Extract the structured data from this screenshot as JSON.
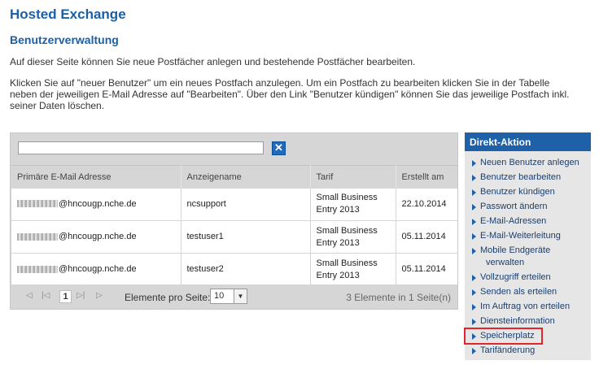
{
  "page": {
    "title": "Hosted Exchange",
    "subtitle": "Benutzerverwaltung",
    "intro": "Auf dieser Seite können Sie neue Postfächer anlegen und bestehende Postfächer bearbeiten.",
    "description": "Klicken Sie auf \"neuer Benutzer\" um ein neues Postfach anzulegen. Um ein Postfach zu bearbeiten klicken Sie in der Tabelle neben der jeweiligen E-Mail Adresse auf \"Bearbeiten\". Über den Link \"Benutzer kündigen\" können Sie das jeweilige Postfach inkl. seiner Daten löschen."
  },
  "grid": {
    "search_value": "",
    "clear_icon": "close-icon",
    "columns": [
      "Primäre E-Mail Adresse",
      "Anzeigename",
      "Tarif",
      "Erstellt am"
    ],
    "rows": [
      {
        "email": "@hncougp.nche.de",
        "name": "ncsupport",
        "tarif_line1": "Small Business",
        "tarif_line2": "Entry 2013",
        "date": "22.10.2014"
      },
      {
        "email": "@hncougp.nche.de",
        "name": "testuser1",
        "tarif_line1": "Small Business",
        "tarif_line2": "Entry 2013",
        "date": "05.11.2014"
      },
      {
        "email": "@hncougp.nche.de",
        "name": "testuser2",
        "tarif_line1": "Small Business",
        "tarif_line2": "Entry 2013",
        "date": "05.11.2014"
      }
    ],
    "pager": {
      "first": "◁",
      "prev": "|◁",
      "current": "1",
      "next": "▷|",
      "last": "▷",
      "per_page_label": "Elemente pro Seite:",
      "per_page_value": "10",
      "info": "3 Elemente in 1 Seite(n)"
    }
  },
  "side": {
    "header": "Direkt-Aktion",
    "items": [
      {
        "label": "Neuen Benutzer anlegen"
      },
      {
        "label": "Benutzer bearbeiten"
      },
      {
        "label": "Benutzer kündigen"
      },
      {
        "label": "Passwort ändern"
      },
      {
        "label": "E-Mail-Adressen"
      },
      {
        "label": "E-Mail-Weiterleitung"
      },
      {
        "label": "Mobile Endgeräte",
        "label2": "verwalten"
      },
      {
        "label": "Vollzugriff erteilen"
      },
      {
        "label": "Senden als erteilen"
      },
      {
        "label": "Im Auftrag von erteilen"
      },
      {
        "label": "Diensteinformation"
      },
      {
        "label": "Speicherplatz",
        "highlighted": true
      },
      {
        "label": "Tarifänderung"
      }
    ]
  },
  "colors": {
    "accent": "#1e61a8",
    "highlight": "#e0262b"
  }
}
